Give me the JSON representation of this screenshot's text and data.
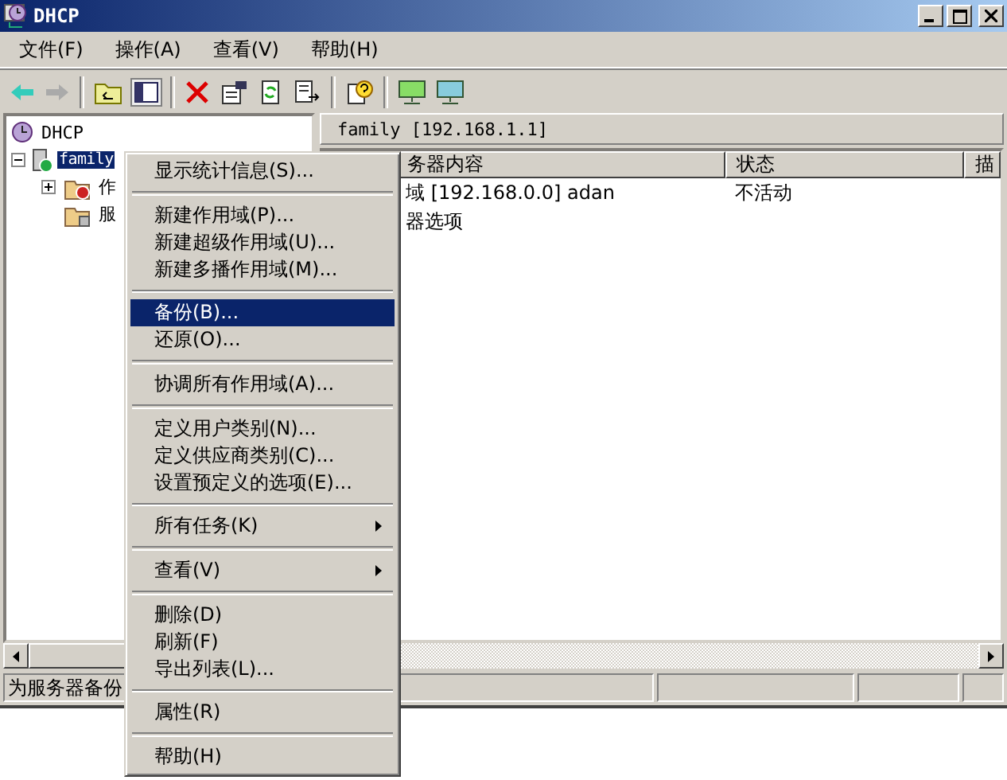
{
  "window": {
    "title": "DHCP"
  },
  "menu_bar": [
    "文件(F)",
    "操作(A)",
    "查看(V)",
    "帮助(H)"
  ],
  "tree": {
    "label": "DHCP",
    "children": [
      {
        "label": "family",
        "selected": true,
        "expanded": true,
        "children": [
          {
            "label": "作",
            "expandable": true,
            "kind": "scope"
          },
          {
            "label": "服",
            "expandable": false,
            "kind": "options"
          }
        ]
      }
    ]
  },
  "right_pane": {
    "header": "family [192.168.1.1]",
    "columns": [
      "务器内容",
      "状态",
      "描"
    ],
    "rows": [
      [
        "域 [192.168.0.0] adan",
        "不活动"
      ],
      [
        "器选项",
        ""
      ]
    ]
  },
  "status_bar": [
    "为服务器备份"
  ],
  "context_menu": [
    {
      "kind": "item",
      "label": "显示统计信息(S)...",
      "selected": false,
      "submenu": false
    },
    {
      "kind": "separator"
    },
    {
      "kind": "item",
      "label": "新建作用域(P)...",
      "selected": false,
      "submenu": false
    },
    {
      "kind": "item",
      "label": "新建超级作用域(U)...",
      "selected": false,
      "submenu": false
    },
    {
      "kind": "item",
      "label": "新建多播作用域(M)...",
      "selected": false,
      "submenu": false
    },
    {
      "kind": "separator"
    },
    {
      "kind": "item",
      "label": "备份(B)...",
      "selected": true,
      "submenu": false
    },
    {
      "kind": "item",
      "label": "还原(O)...",
      "selected": false,
      "submenu": false
    },
    {
      "kind": "separator"
    },
    {
      "kind": "item",
      "label": "协调所有作用域(A)...",
      "selected": false,
      "submenu": false
    },
    {
      "kind": "separator"
    },
    {
      "kind": "item",
      "label": "定义用户类别(N)...",
      "selected": false,
      "submenu": false
    },
    {
      "kind": "item",
      "label": "定义供应商类别(C)...",
      "selected": false,
      "submenu": false
    },
    {
      "kind": "item",
      "label": "设置预定义的选项(E)...",
      "selected": false,
      "submenu": false
    },
    {
      "kind": "separator"
    },
    {
      "kind": "item",
      "label": "所有任务(K)",
      "selected": false,
      "submenu": true
    },
    {
      "kind": "separator"
    },
    {
      "kind": "item",
      "label": "查看(V)",
      "selected": false,
      "submenu": true
    },
    {
      "kind": "separator"
    },
    {
      "kind": "item",
      "label": "删除(D)",
      "selected": false,
      "submenu": false
    },
    {
      "kind": "item",
      "label": "刷新(F)",
      "selected": false,
      "submenu": false
    },
    {
      "kind": "item",
      "label": "导出列表(L)...",
      "selected": false,
      "submenu": false
    },
    {
      "kind": "separator"
    },
    {
      "kind": "item",
      "label": "属性(R)",
      "selected": false,
      "submenu": false
    },
    {
      "kind": "separator"
    },
    {
      "kind": "item",
      "label": "帮助(H)",
      "selected": false,
      "submenu": false
    }
  ]
}
